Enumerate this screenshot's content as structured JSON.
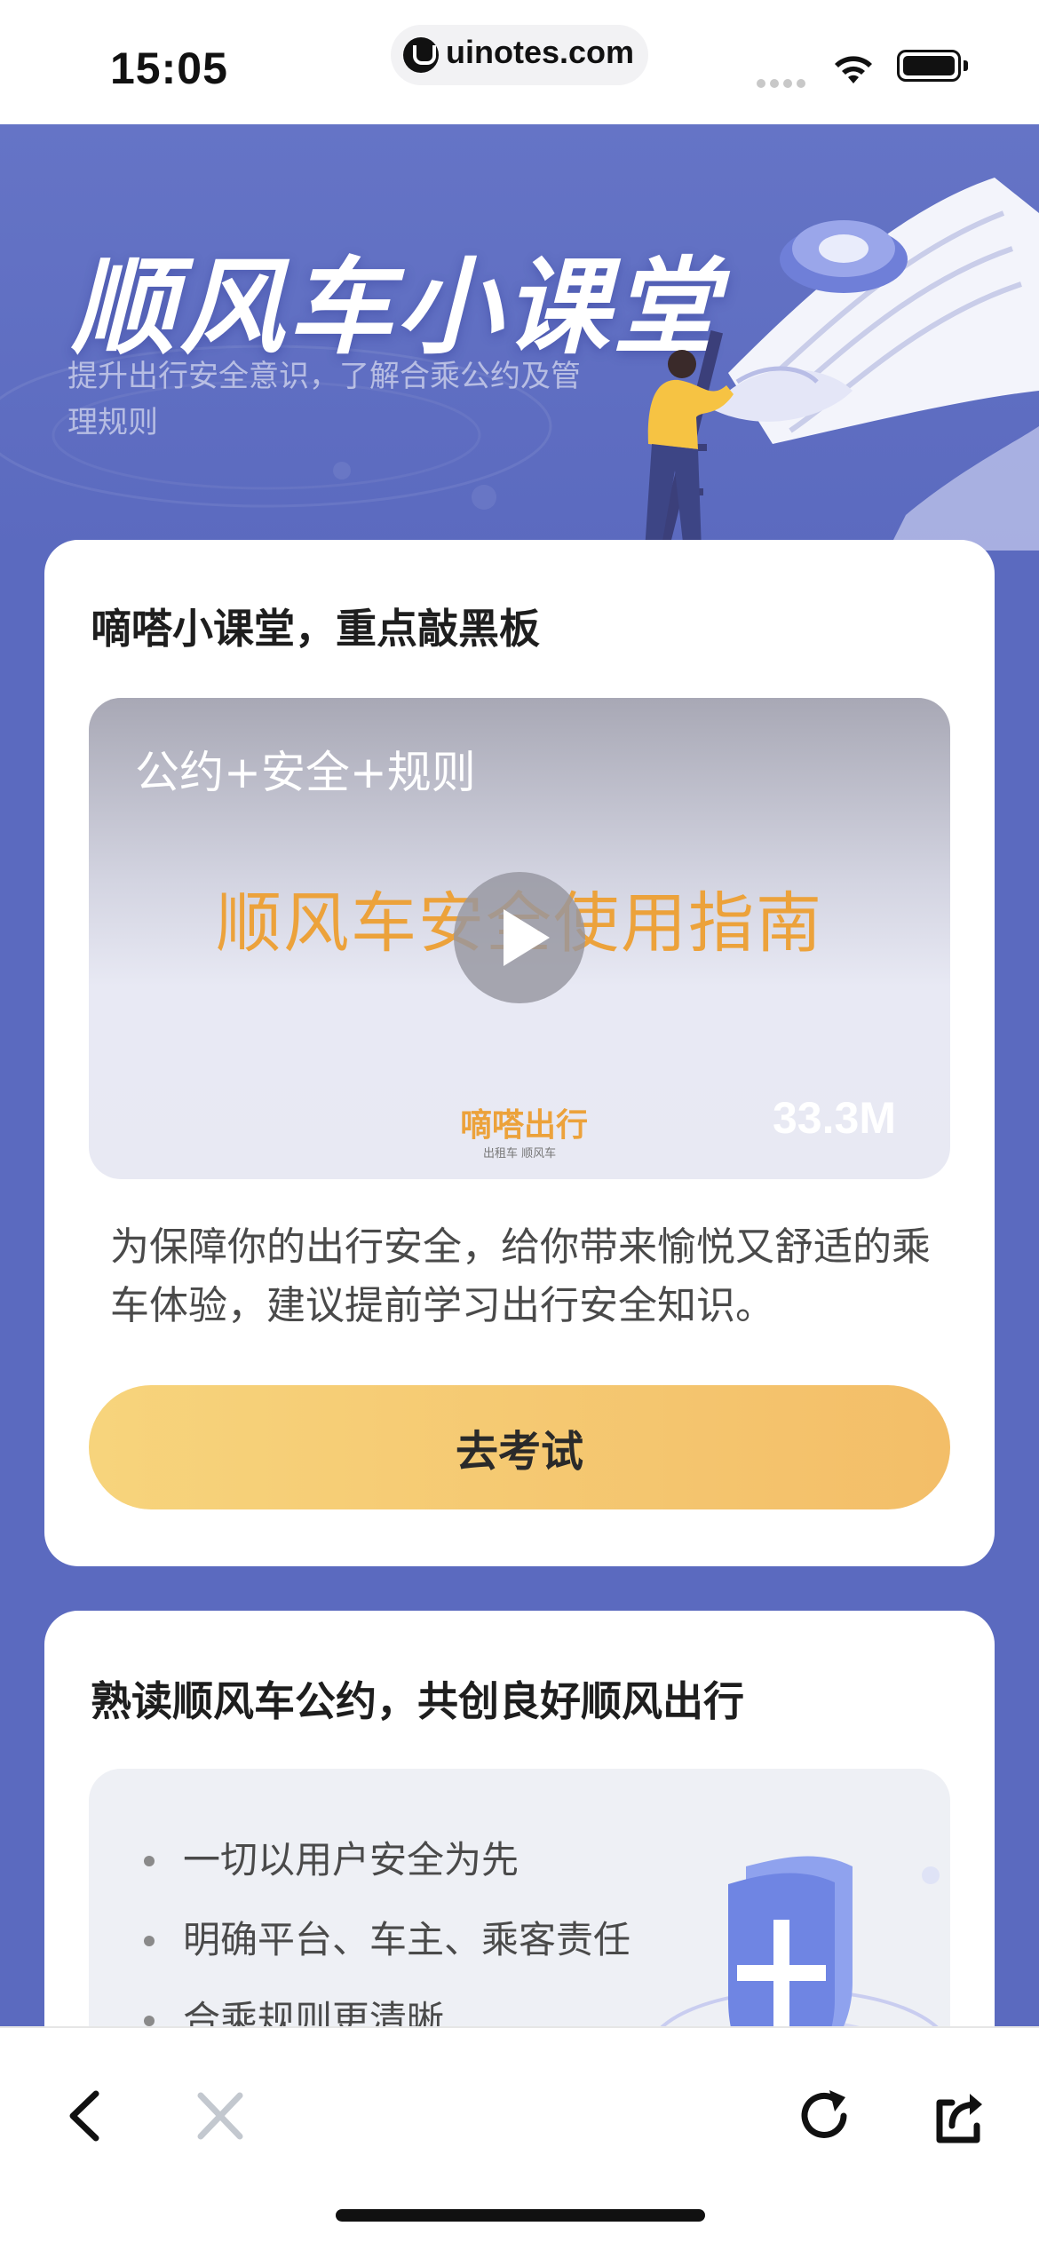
{
  "status_bar": {
    "time": "15:05",
    "url": "uinotes.com"
  },
  "hero": {
    "title": "顺风车小课堂",
    "subtitle": "提升出行安全意识，了解合乘公约及管理规则"
  },
  "card1": {
    "title": "嘀嗒小课堂，重点敲黑板",
    "video": {
      "tag": "公约+安全+规则",
      "heading": "顺风车安全使用指南",
      "brand": "嘀嗒出行",
      "brand_sub": "出租车 顺风车",
      "size": "33.3M"
    },
    "description": "为保障你的出行安全，给你带来愉悦又舒适的乘车体验，建议提前学习出行安全知识。",
    "button_label": "去考试"
  },
  "card2": {
    "title": "熟读顺风车公约，共创良好顺风出行",
    "rules": [
      "一切以用户安全为先",
      "明确平台、车主、乘客责任",
      "合乘规则更清晰"
    ]
  },
  "colors": {
    "page_bg": "#5b6abf",
    "accent_orange": "#eca23b",
    "button_gradient_start": "#f7d47c",
    "button_gradient_end": "#f3be68"
  },
  "toolbar": {
    "icons": [
      "back-icon",
      "close-icon",
      "reload-icon",
      "share-icon"
    ]
  }
}
